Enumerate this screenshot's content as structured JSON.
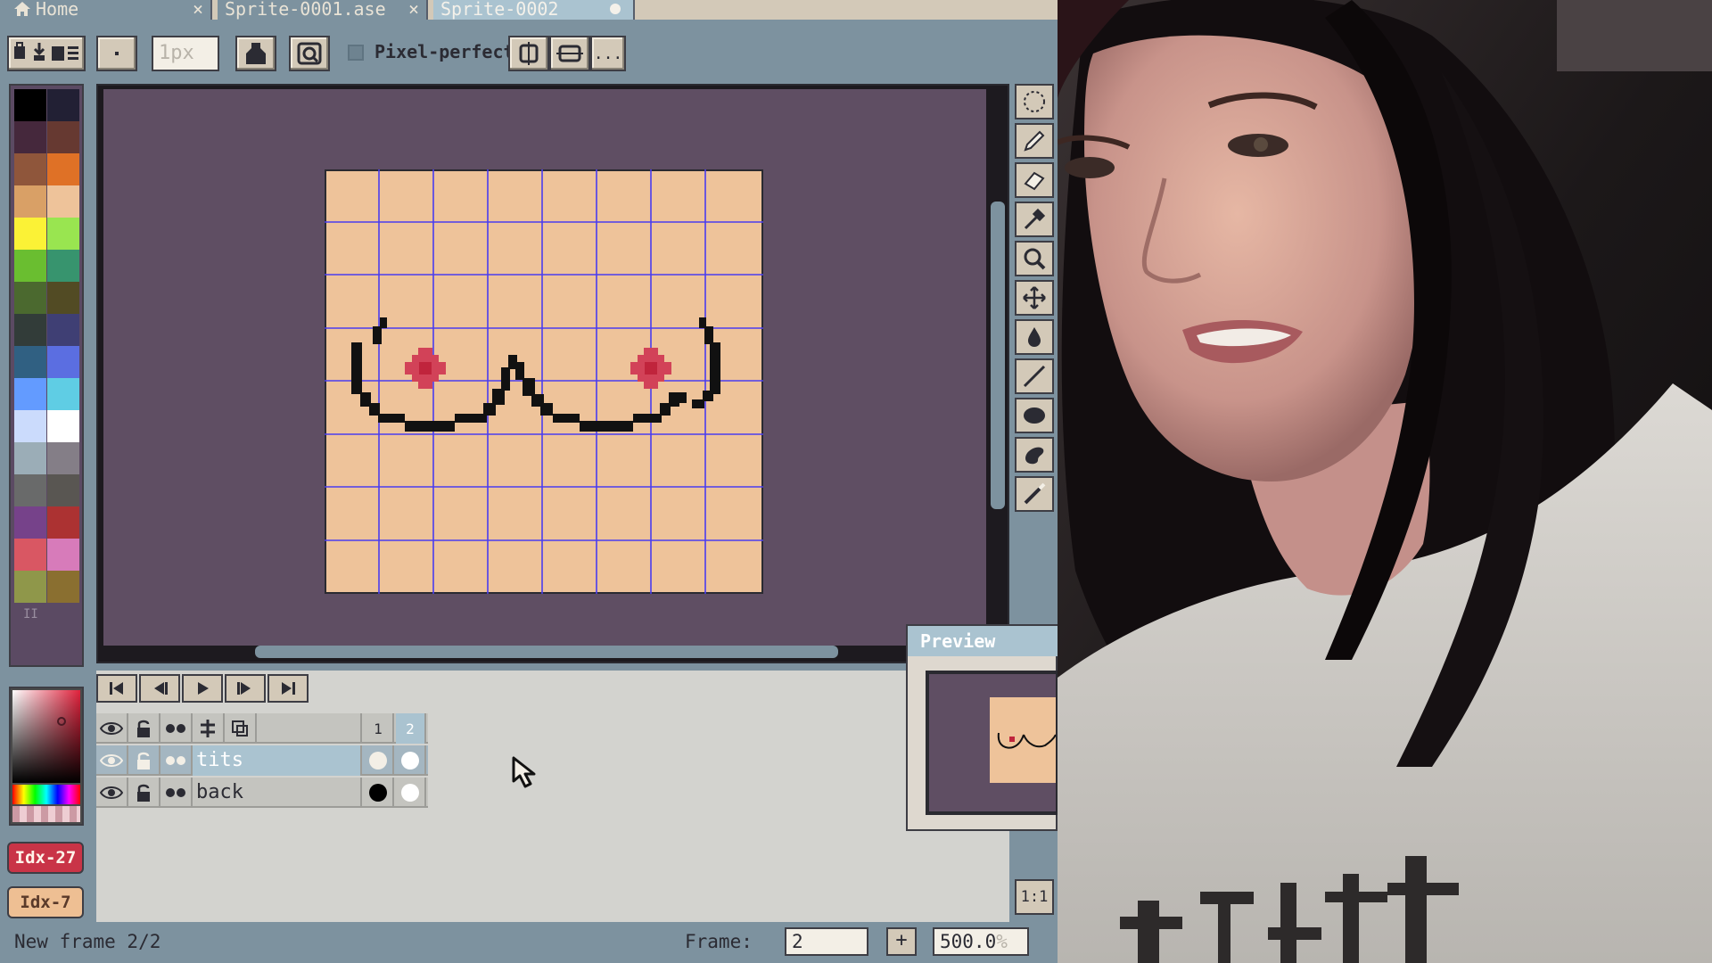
{
  "tabs": [
    {
      "label": "Home",
      "active": false,
      "closable": true
    },
    {
      "label": "Sprite-0001.ase",
      "active": false,
      "closable": true
    },
    {
      "label": "Sprite-0002",
      "active": true,
      "modified": true
    }
  ],
  "toolbar": {
    "brush_size_placeholder": "1px",
    "pixel_perfect_label": "Pixel-perfect",
    "pixel_perfect_checked": false,
    "more_label": "..."
  },
  "palette": {
    "colors": [
      "#000000",
      "#222034",
      "#45283c",
      "#663931",
      "#8f563b",
      "#df7126",
      "#d9a066",
      "#eec39a",
      "#fbf236",
      "#99e550",
      "#6abe30",
      "#37946e",
      "#4b692f",
      "#524b24",
      "#323c39",
      "#3f3f74",
      "#306082",
      "#5b6ee1",
      "#639bff",
      "#5fcde4",
      "#cbdbfc",
      "#ffffff",
      "#9badb7",
      "#847e87",
      "#696a6a",
      "#595652",
      "#76428a",
      "#ac3232",
      "#d95763",
      "#d77bba",
      "#8f974a",
      "#8a6f30"
    ],
    "grip_label": "II"
  },
  "colors": {
    "foreground_index": "Idx-27",
    "background_index": "Idx-7",
    "foreground_hex": "#ac3232",
    "background_hex": "#eec39a",
    "accent": "#aac3d0",
    "ui_face": "#d3c9b8",
    "ui_frame": "#7d929f",
    "canvas_bg": "#5f4e63"
  },
  "tools": [
    {
      "name": "marquee-icon"
    },
    {
      "name": "pencil-icon"
    },
    {
      "name": "eraser-icon"
    },
    {
      "name": "eyedropper-icon"
    },
    {
      "name": "zoom-icon"
    },
    {
      "name": "move-icon"
    },
    {
      "name": "paint-bucket-icon"
    },
    {
      "name": "line-icon"
    },
    {
      "name": "ellipse-icon"
    },
    {
      "name": "contour-icon"
    },
    {
      "name": "blur-icon"
    }
  ],
  "zoom_1to1_label": "1:1",
  "timeline": {
    "frames": [
      "1",
      "2"
    ],
    "current_frame": 2,
    "layers": [
      {
        "name": "tits",
        "selected": true,
        "cels": [
          "#f3efe6",
          "#ffffff"
        ]
      },
      {
        "name": "back",
        "selected": false,
        "cels": [
          "#000000",
          "#ffffff"
        ]
      }
    ]
  },
  "preview": {
    "title": "Preview"
  },
  "status": {
    "message": "New frame 2/2",
    "frame_label": "Frame:",
    "frame_value": "2",
    "add_label": "+",
    "zoom_value": "500.0",
    "zoom_unit": "%"
  }
}
